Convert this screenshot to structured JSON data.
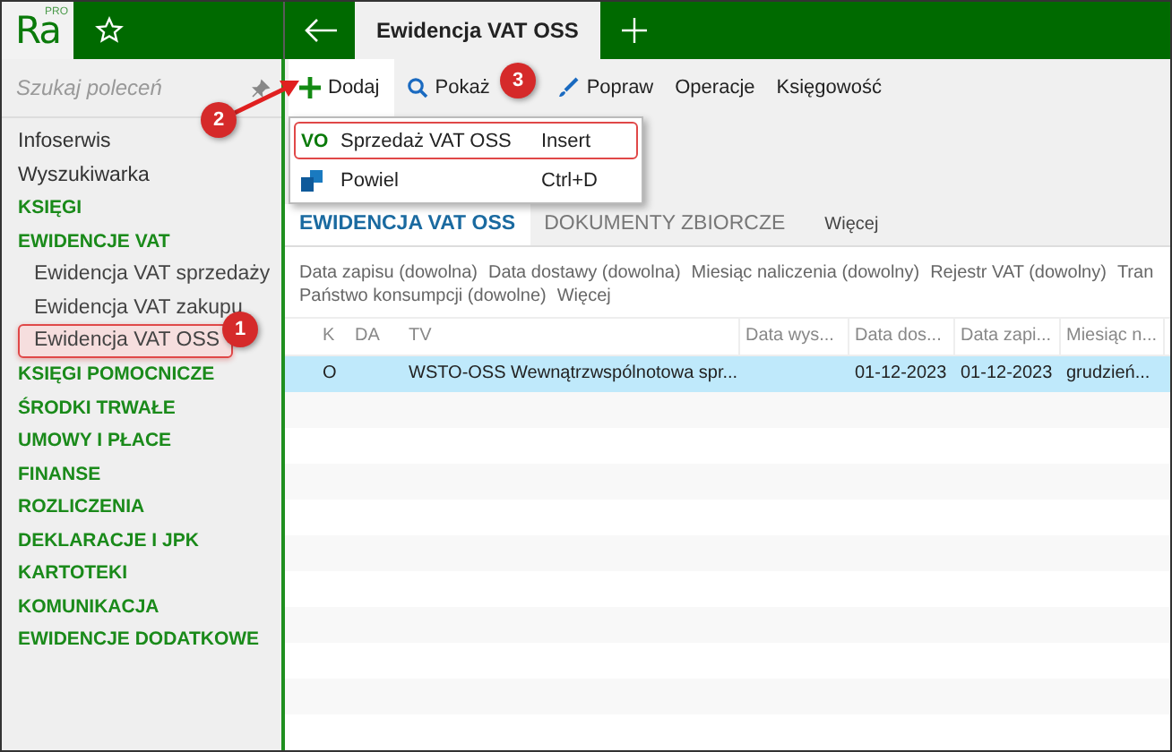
{
  "app": {
    "logo": "Ra",
    "logo_badge": "PRO"
  },
  "tabs": [
    {
      "label": "Ewidencja VAT OSS",
      "selected": true
    }
  ],
  "search": {
    "placeholder": "Szukaj poleceń"
  },
  "sidebar": {
    "items": [
      {
        "label": "Infoserwis",
        "kind": "link"
      },
      {
        "label": "Wyszukiwarka",
        "kind": "link"
      },
      {
        "label": "KSIĘGI",
        "kind": "section"
      },
      {
        "label": "EWIDENCJE VAT",
        "kind": "section",
        "children": [
          {
            "label": "Ewidencja VAT sprzedaży",
            "highlighted": false
          },
          {
            "label": "Ewidencja VAT zakupu",
            "highlighted": false
          },
          {
            "label": "Ewidencja VAT OSS",
            "highlighted": true
          }
        ]
      },
      {
        "label": "KSIĘGI POMOCNICZE",
        "kind": "section"
      },
      {
        "label": "ŚRODKI TRWAŁE",
        "kind": "section"
      },
      {
        "label": "UMOWY I PŁACE",
        "kind": "section"
      },
      {
        "label": "FINANSE",
        "kind": "section"
      },
      {
        "label": "ROZLICZENIA",
        "kind": "section"
      },
      {
        "label": "DEKLARACJE I JPK",
        "kind": "section"
      },
      {
        "label": "KARTOTEKI",
        "kind": "section"
      },
      {
        "label": "KOMUNIKACJA",
        "kind": "section"
      },
      {
        "label": "EWIDENCJE DODATKOWE",
        "kind": "section"
      }
    ]
  },
  "toolbar": [
    {
      "label": "Dodaj",
      "kind": "add"
    },
    {
      "label": "Pokaż",
      "kind": "search"
    },
    {
      "label": "Popraw",
      "kind": "edit"
    },
    {
      "label": "Operacje",
      "kind": "text"
    },
    {
      "label": "Księgowość",
      "kind": "text"
    }
  ],
  "menu": [
    {
      "icon_text": "VO",
      "label": "Sprzedaż VAT OSS",
      "shortcut": "Insert",
      "highlighted": true
    },
    {
      "label": "Powiel",
      "shortcut": "Ctrl+D",
      "highlighted": false
    }
  ],
  "view_tabs": [
    {
      "label": "EWIDENCJA VAT OSS",
      "kind": "tab",
      "selected": true
    },
    {
      "label": "DOKUMENTY ZBIORCZE",
      "kind": "tab",
      "selected": false
    },
    {
      "label": "Więcej",
      "kind": "more",
      "selected": false
    }
  ],
  "filters": [
    "Data zapisu (dowolna)",
    "Data dostawy (dowolna)",
    "Miesiąc naliczenia (dowolny)",
    "Rejestr VAT (dowolny)",
    "Tran",
    "Państwo konsumpcji (dowolne)",
    "Więcej"
  ],
  "table": {
    "columns": [
      "K",
      "DA",
      "TV",
      "Data wys...",
      "Data dos...",
      "Data zapi...",
      "Miesiąc n..."
    ],
    "rows": [
      {
        "selected": true,
        "cells": [
          "O",
          "",
          "WSTO-OSS Wewnątrzwspólnotowa spr...",
          "",
          "01-12-2023",
          "01-12-2023",
          "grudzień..."
        ]
      }
    ]
  },
  "callouts": [
    {
      "label": "1"
    },
    {
      "label": "2"
    },
    {
      "label": "3"
    }
  ]
}
